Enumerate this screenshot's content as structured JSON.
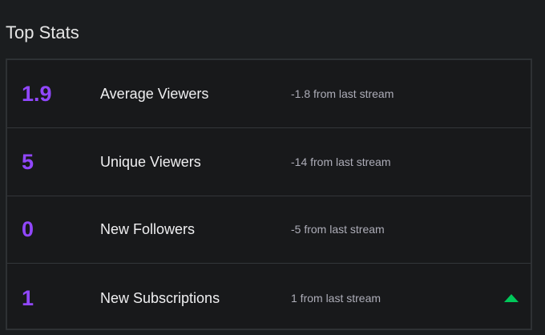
{
  "section": {
    "title": "Top Stats"
  },
  "stats": [
    {
      "value": "1.9",
      "label": "Average Viewers",
      "delta": "-1.8 from last stream",
      "trend": "none"
    },
    {
      "value": "5",
      "label": "Unique Viewers",
      "delta": "-14 from last stream",
      "trend": "none"
    },
    {
      "value": "0",
      "label": "New Followers",
      "delta": "-5 from last stream",
      "trend": "none"
    },
    {
      "value": "1",
      "label": "New Subscriptions",
      "delta": "1 from last stream",
      "trend": "up"
    }
  ],
  "colors": {
    "accent": "#9147ff",
    "trend_up": "#00c85a"
  },
  "icons": {
    "trend_up": "triangle-up-icon"
  }
}
